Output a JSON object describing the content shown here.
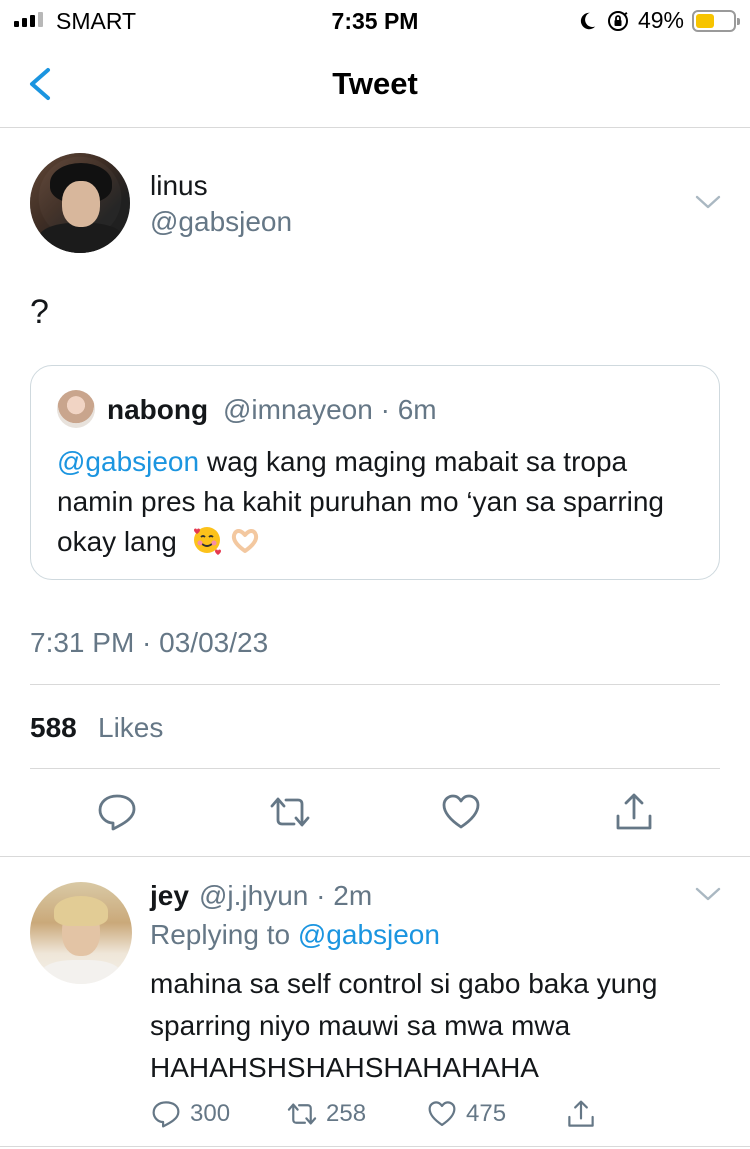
{
  "status_bar": {
    "carrier": "SMART",
    "time": "7:35 PM",
    "battery_percent": "49%",
    "battery_level": 0.49,
    "signal_bars": 3,
    "icons": [
      "signal-icon",
      "moon-icon",
      "orientation-lock-icon",
      "battery-icon"
    ]
  },
  "nav": {
    "title": "Tweet",
    "back_icon": "back-chevron-icon"
  },
  "tweet": {
    "author_name": "linus",
    "author_handle": "@gabsjeon",
    "text": "?",
    "quote": {
      "name": "nabong",
      "meta": "@imnayeon · 6m",
      "mention": "@gabsjeon",
      "body": " wag kang maging mabait sa tropa namin pres ha kahit puruhan mo ‘yan sa sparring okay lang",
      "emojis": [
        "smiling-face-with-hearts-emoji",
        "heart-hands-emoji"
      ]
    },
    "timestamp": "7:31 PM · 03/03/23",
    "likes_count": "588",
    "likes_label": "Likes",
    "actions": [
      "reply-icon",
      "retweet-icon",
      "like-icon",
      "share-icon"
    ]
  },
  "reply": {
    "name": "jey",
    "meta": "@j.jhyun · 2m",
    "replying_prefix": "Replying to",
    "replying_handle": "@gabsjeon",
    "body": "mahina sa self control si gabo baka yung sparring niyo mauwi sa mwa mwa HAHAHSHSHAHSHAHAHAHA",
    "reply_count": "300",
    "retweet_count": "258",
    "like_count": "475"
  },
  "colors": {
    "accent": "#1b95e0",
    "secondary_text": "#657786",
    "primary_text": "#14171a",
    "border": "#d9d9d9"
  }
}
